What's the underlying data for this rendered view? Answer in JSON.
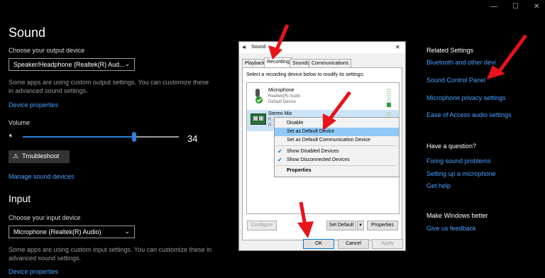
{
  "window": {
    "minimize": "—",
    "maximize": "☐",
    "close": "✕"
  },
  "sound": {
    "title": "Sound",
    "output": {
      "label": "Choose your output device",
      "device": "Speaker/Headphone (Realtek(R) Aud...",
      "note_line1": "Some apps are using custom output settings. You can customize these",
      "note_line2": "in advanced sound settings.",
      "device_properties": "Device properties"
    },
    "volume": {
      "label": "Volume",
      "value": "34",
      "level": 34
    },
    "troubleshoot": "Troubleshoot",
    "manage": "Manage sound devices",
    "input": {
      "title": "Input",
      "label": "Choose your input device",
      "device": "Microphone (Realtek(R) Audio)",
      "note_line1": "Some apps are using custom input settings. You can customize these in",
      "note_line2": "advanced sound settings.",
      "device_properties": "Device properties"
    }
  },
  "related": {
    "title": "Related Settings",
    "links": [
      "Bluetooth and other devi",
      "Sound Control Panel",
      "Microphone privacy settings",
      "Ease of Access audio settings"
    ]
  },
  "question": {
    "title": "Have a question?",
    "links": [
      "Fixing sound problems",
      "Setting up a microphone",
      "Get help"
    ]
  },
  "better": {
    "title": "Make Windows better",
    "link": "Give us feedback"
  },
  "dialog": {
    "title": "Sound",
    "close": "✕",
    "tabs": [
      "Playback",
      "Recording",
      "Sounds",
      "Communications"
    ],
    "instruction": "Select a recording device below to modify its settings:",
    "devices": [
      {
        "name": "Microphone",
        "driver": "Realtek(R) Audio",
        "status": "Default Device"
      },
      {
        "name": "Stereo Mix",
        "driver": "R",
        "status": "R"
      }
    ],
    "buttons": {
      "configure": "Configure",
      "set_default": "Set Default",
      "properties": "Properties",
      "ok": "OK",
      "cancel": "Cancel",
      "apply": "Apply"
    },
    "context_menu": [
      "Disable",
      "Set as Default Device",
      "Set as Default Communication Device",
      "Show Disabled Devices",
      "Show Disconnected Devices",
      "Properties"
    ]
  },
  "colors": {
    "accent": "#2f7fd8",
    "link": "#4aa3ff",
    "annotation_arrow": "#e8131b"
  }
}
